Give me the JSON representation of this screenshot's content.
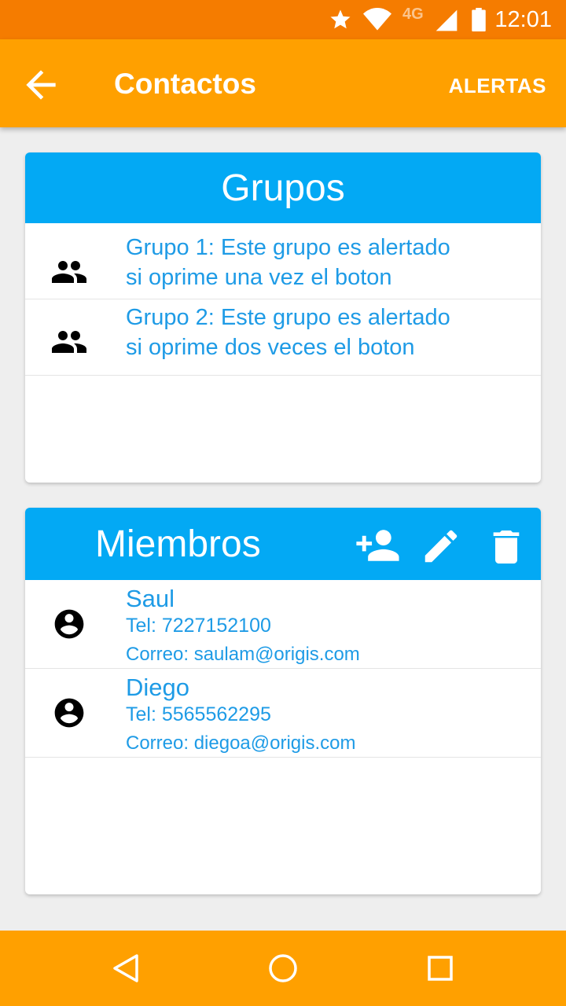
{
  "status_bar": {
    "time": "12:01",
    "network": "4G",
    "icons": [
      "star-icon",
      "wifi-icon",
      "cell-signal-icon",
      "battery-icon"
    ]
  },
  "app_bar": {
    "title": "Contactos",
    "action_label": "ALERTAS",
    "back_icon": "arrow-back-icon"
  },
  "groups": {
    "header": "Grupos",
    "items": [
      {
        "line1": "Grupo 1: Este grupo es alertado",
        "line2": "si oprime una vez el boton",
        "icon": "group-icon"
      },
      {
        "line1": "Grupo 2: Este grupo es alertado",
        "line2": "si oprime dos veces el boton",
        "icon": "group-icon"
      }
    ]
  },
  "members": {
    "header": "Miembros",
    "actions": [
      "add-person-icon",
      "edit-icon",
      "delete-icon"
    ],
    "items": [
      {
        "name": "Saul",
        "tel": "Tel: 7227152100",
        "email": "Correo: saulam@origis.com",
        "icon": "account-circle-icon"
      },
      {
        "name": "Diego",
        "tel": "Tel: 5565562295",
        "email": "Correo: diegoa@origis.com",
        "icon": "account-circle-icon"
      }
    ]
  },
  "nav_bar": {
    "buttons": [
      "back-triangle-icon",
      "home-circle-icon",
      "recents-square-icon"
    ]
  },
  "colors": {
    "status_bar": "#F57C00",
    "app_bar": "#FFA000",
    "card_header": "#03A9F4",
    "text_accent": "#1E9BE6",
    "background": "#EEEEEE"
  }
}
